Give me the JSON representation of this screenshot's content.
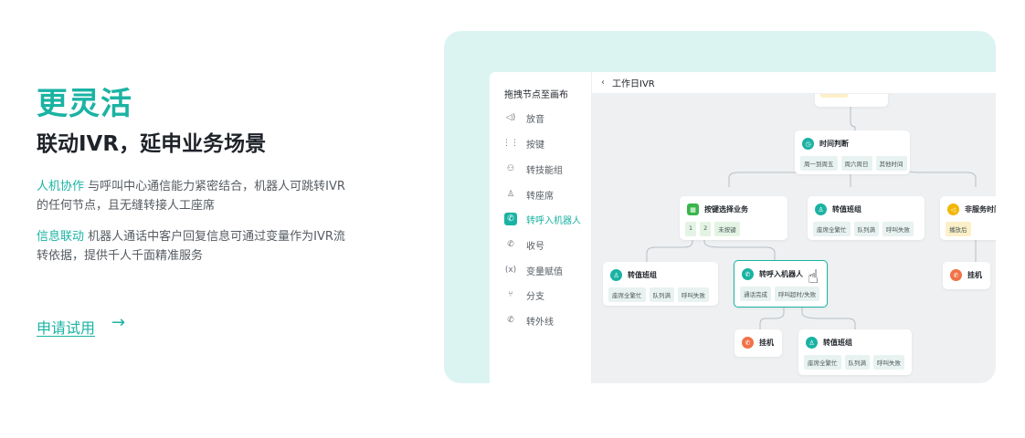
{
  "hero": {
    "title": "更灵活",
    "subtitle": "联动IVR，延申业务场景",
    "p1_highlight": "人机协作",
    "p1_text": " 与呼叫中心通信能力紧密结合，机器人可跳转IVR的任何节点，且无缝转接人工座席",
    "p2_highlight": "信息联动",
    "p2_text": " 机器人通话中客户回复信息可通过变量作为IVR流转依据，提供千人千面精准服务",
    "cta": "申请试用",
    "cta_arrow": "→"
  },
  "colors": {
    "accent": "#1ab3a3",
    "frame_bg": "#dbf4f1"
  },
  "sidebar": {
    "title": "拖拽节点至画布",
    "items": [
      {
        "label": "放音",
        "icon": "speaker-icon"
      },
      {
        "label": "按键",
        "icon": "keypad-icon"
      },
      {
        "label": "转技能组",
        "icon": "group-icon"
      },
      {
        "label": "转座席",
        "icon": "agent-icon"
      },
      {
        "label": "转呼入机器人",
        "icon": "robot-icon",
        "active": true
      },
      {
        "label": "收号",
        "icon": "phone-icon"
      },
      {
        "label": "变量赋值",
        "icon": "variable-icon"
      },
      {
        "label": "分支",
        "icon": "branch-icon"
      },
      {
        "label": "转外线",
        "icon": "phone-out-icon"
      }
    ]
  },
  "editor": {
    "title": "工作日IVR"
  },
  "nodes": {
    "time": {
      "title": "时间判断",
      "tags": [
        "周一到周五",
        "周六周日",
        "其他时间"
      ]
    },
    "key": {
      "title": "按键选择业务",
      "tags": [
        "1",
        "2",
        "未按键"
      ]
    },
    "skill1": {
      "title": "转值班组",
      "tags": [
        "座席全繁忙",
        "队列满",
        "呼叫失败"
      ]
    },
    "nonservice": {
      "title": "非服务时间",
      "tags": [
        "播放后"
      ]
    },
    "skill2": {
      "title": "转值班组",
      "tags": [
        "座席全繁忙",
        "队列满",
        "呼叫失败"
      ]
    },
    "robot": {
      "title": "转呼入机器人",
      "tags": [
        "通话完成",
        "呼叫超时/失败"
      ]
    },
    "hangup1": {
      "title": "挂机"
    },
    "hangup2": {
      "title": "挂机"
    },
    "skill3": {
      "title": "转值班组",
      "tags": [
        "座席全繁忙",
        "队列满",
        "呼叫失败"
      ]
    }
  }
}
